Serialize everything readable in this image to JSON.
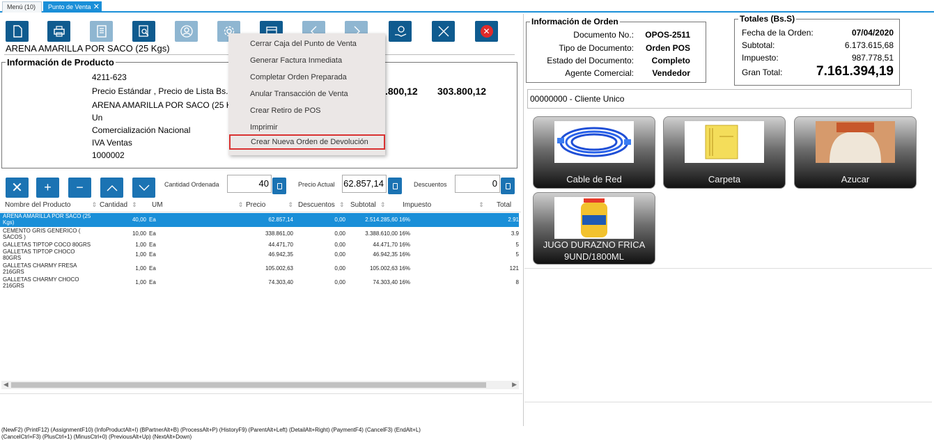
{
  "tabs": [
    {
      "label": "Menú (10)"
    },
    {
      "label": "Punto de Venta"
    }
  ],
  "toolbar": {
    "icons": [
      "new-document-icon",
      "print-icon",
      "document-list-icon",
      "search-document-icon",
      "user-icon",
      "gear-icon",
      "calendar-icon",
      "previous-icon",
      "next-icon",
      "payment-icon",
      "cancel-icon",
      "close-icon"
    ]
  },
  "product": {
    "name": "ARENA AMARILLA POR SACO (25 Kgs)",
    "info_title": "Información de Producto",
    "code": "4211-623",
    "price_list": "Precio Estándar , Precio de Lista Bs.S",
    "description": "ARENA AMARILLA POR SACO (25 Kgs)",
    "uom": "Un",
    "category": "Comercialización Nacional",
    "tax": "IVA Ventas",
    "number": "1000002",
    "price_1": ".800,12",
    "price_2": "303.800,12"
  },
  "context_menu": {
    "items": [
      "Cerrar Caja del Punto de Venta",
      "Generar Factura Inmediata",
      "Completar Orden Preparada",
      "Anular Transacción de Venta",
      "Crear Retiro de POS",
      "Imprimir",
      "Crear Nueva Orden de Devolución"
    ]
  },
  "line_controls": {
    "qty_label": "Cantidad Ordenada",
    "qty_value": "40",
    "price_label": "Precio Actual",
    "price_value": "62.857,14",
    "discount_label": "Descuentos",
    "discount_value": "0"
  },
  "grid": {
    "columns": [
      "Nombre del Producto",
      "Cantidad",
      "UM",
      "Precio",
      "Descuentos",
      "Subtotal",
      "Impuesto",
      "Total"
    ],
    "rows": [
      {
        "name1": "ARENA AMARILLA POR SACO (25",
        "name2": "Kgs)",
        "qty": "40,00",
        "um": "Ea",
        "price": "62.857,14",
        "disc": "0,00",
        "subtotal": "2.514.285,60",
        "tax": "16%",
        "total": "2.91"
      },
      {
        "name1": "CEMENTO GRIS GENERICO (",
        "name2": "SACOS )",
        "qty": "10,00",
        "um": "Ea",
        "price": "338.861,00",
        "disc": "0,00",
        "subtotal": "3.388.610,00",
        "tax": "16%",
        "total": "3.9"
      },
      {
        "name1": "GALLETAS TIPTOP COCO 80GRS",
        "name2": "",
        "qty": "1,00",
        "um": "Ea",
        "price": "44.471,70",
        "disc": "0,00",
        "subtotal": "44.471,70",
        "tax": "16%",
        "total": "5"
      },
      {
        "name1": "GALLETAS TIPTOP CHOCO",
        "name2": "80GRS",
        "qty": "1,00",
        "um": "Ea",
        "price": "46.942,35",
        "disc": "0,00",
        "subtotal": "46.942,35",
        "tax": "16%",
        "total": "5"
      },
      {
        "name1": "GALLETAS CHARMY FRESA",
        "name2": "216GRS",
        "qty": "1,00",
        "um": "Ea",
        "price": "105.002,63",
        "disc": "0,00",
        "subtotal": "105.002,63",
        "tax": "16%",
        "total": "121"
      },
      {
        "name1": "GALLETAS CHARMY CHOCO",
        "name2": "216GRS",
        "qty": "1,00",
        "um": "Ea",
        "price": "74.303,40",
        "disc": "0,00",
        "subtotal": "74.303,40",
        "tax": "16%",
        "total": "8"
      }
    ]
  },
  "order_info": {
    "title": "Información de Orden",
    "doc_label": "Documento No.:",
    "doc_value": "OPOS-2511",
    "type_label": "Tipo de Documento:",
    "type_value": "Orden POS",
    "status_label": "Estado del Documento:",
    "status_value": "Completo",
    "agent_label": "Agente Comercial:",
    "agent_value": "Vendedor"
  },
  "totals": {
    "title": "Totales (Bs.S)",
    "date_label": "Fecha de la Orden:",
    "date_value": "07/04/2020",
    "subtotal_label": "Subtotal:",
    "subtotal_value": "6.173.615,68",
    "tax_label": "Impuesto:",
    "tax_value": "987.778,51",
    "grand_label": "Gran Total:",
    "grand_value": "7.161.394,19"
  },
  "customer": "00000000 - Cliente Unico",
  "product_cards": [
    {
      "label": "Cable de Red"
    },
    {
      "label": "Carpeta"
    },
    {
      "label": "Azucar"
    },
    {
      "label1": "JUGO DURAZNO FRICA",
      "label2": "9UND/1800ML"
    }
  ],
  "footer": {
    "line1": "(NewF2) (PrintF12) (AssignmentF10) (InfoProductAlt+I) (BPartnerAlt+B) (ProcessAlt+P) (HistoryF9) (ParentAlt+Left) (DetailAlt+Right) (PaymentF4) (CancelF3) (EndAlt+L)",
    "line2": "(CancelCtrl+F3) (PlusCtrl+1) (MinusCtrl+0) (PreviousAlt+Up) (NextAlt+Down)"
  }
}
